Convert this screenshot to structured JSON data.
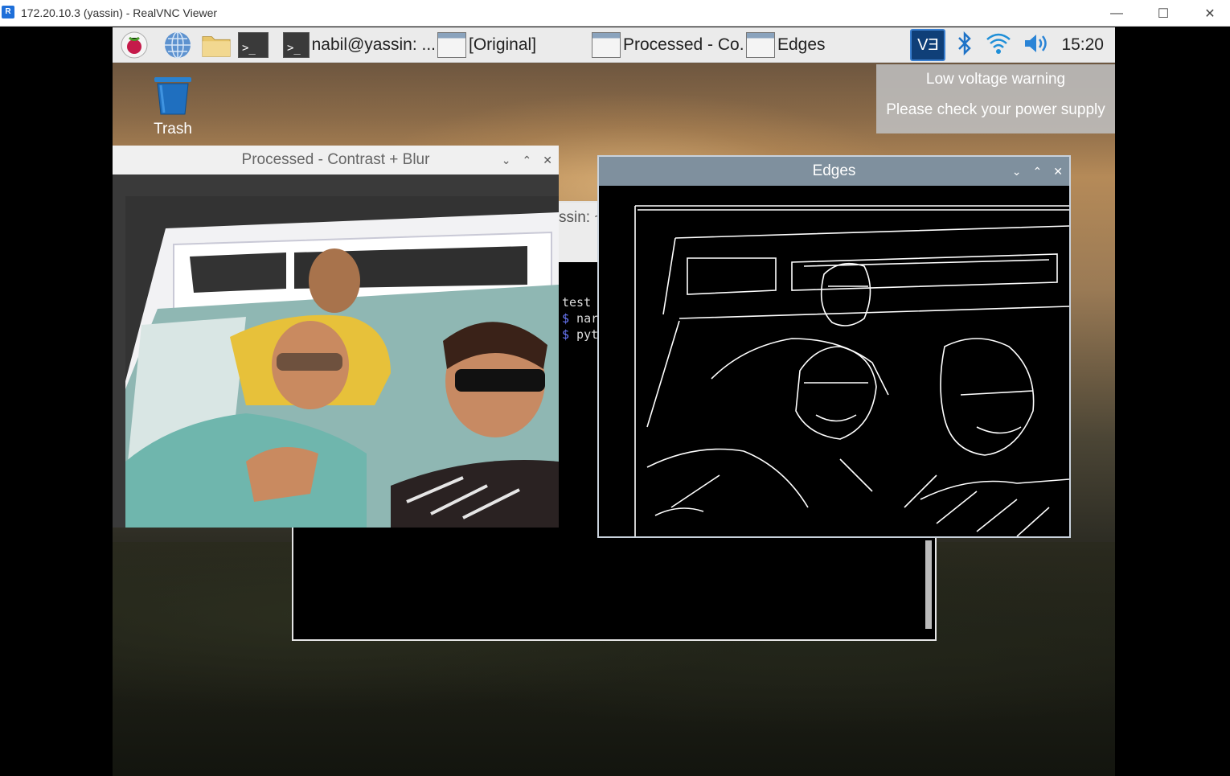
{
  "vnc": {
    "title": "172.20.10.3 (yassin) - RealVNC Viewer",
    "logo_text": "R",
    "controls": [
      "—",
      "☐",
      "✕"
    ]
  },
  "taskbar": {
    "terminal_button_label": "nabil@yassin: ...",
    "original_button_label": "[Original]",
    "processed_button_label": "Processed - Co...",
    "edges_button_label": "Edges",
    "clock": "15:20",
    "vnc_tray_text": "VƎ"
  },
  "notification": {
    "line1": "Low voltage warning",
    "line2": "Please check your power supply"
  },
  "desktop": {
    "trash_label": "Trash"
  },
  "terminal": {
    "partial_title": "ssin: ~",
    "line1": "test",
    "line2_prompt": "$",
    "line2_text": " nar",
    "line3_prompt": "$",
    "line3_text": " pyt"
  },
  "processed_window": {
    "title": "Processed - Contrast + Blur"
  },
  "edges_window": {
    "title": "Edges"
  },
  "window_controls": {
    "minimize": "⌄",
    "maximize": "⌃",
    "close": "✕"
  },
  "colors": {
    "taskbar_bg": "#ebebeb",
    "edges_titlebar": "#7f909e",
    "vnc_blue": "#1e6fd9"
  }
}
